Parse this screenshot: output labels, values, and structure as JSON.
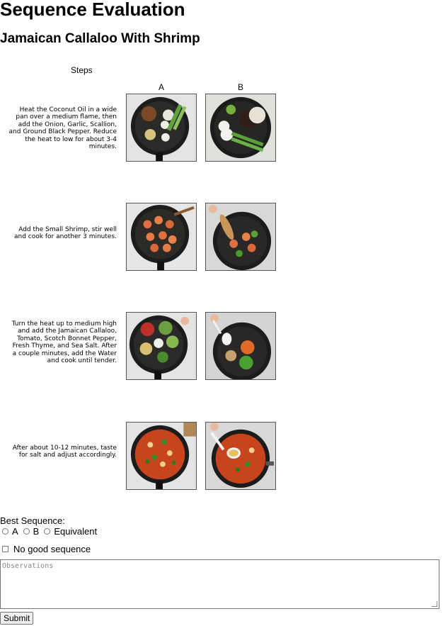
{
  "page": {
    "title": "Sequence Evaluation",
    "subtitle": "Jamaican Callaloo With Shrimp"
  },
  "table": {
    "steps_header": "Steps",
    "column_a": "A",
    "column_b": "B",
    "steps": [
      {
        "text": "Heat the Coconut Oil in a wide pan over a medium flame, then add the Onion, Garlic, Scallion, and Ground Black Pepper. Reduce the heat to low for about 3-4 minutes.",
        "image_a": "pan with spices, onion, garlic and scallion",
        "image_b": "pan with onion, black pepper, rice and scallion"
      },
      {
        "text": "Add the Small Shrimp, stir well and cook for another 3 minutes.",
        "image_a": "shrimp frying in pan",
        "image_b": "shrimp in pan stirred with wooden spoon"
      },
      {
        "text": "Turn the heat up to medium high and add the Jamaican Callaloo, Tomato, Scotch Bonnet Pepper, Fresh Thyme, and Sea Salt. After a couple minutes, add the Water and cook until tender.",
        "image_a": "pan with tomato, callaloo and vegetables",
        "image_b": "water poured into pan with vegetables"
      },
      {
        "text": "After about 10-12 minutes, taste for salt and adjust accordingly.",
        "image_a": "tomato shrimp stew in pan",
        "image_b": "stew tasted with spoon"
      }
    ]
  },
  "form": {
    "best_sequence_label": "Best Sequence:",
    "options": [
      "A",
      "B",
      "Equivalent"
    ],
    "no_good_label": "No good sequence",
    "observations_placeholder": "Observations",
    "submit_label": "Submit"
  }
}
